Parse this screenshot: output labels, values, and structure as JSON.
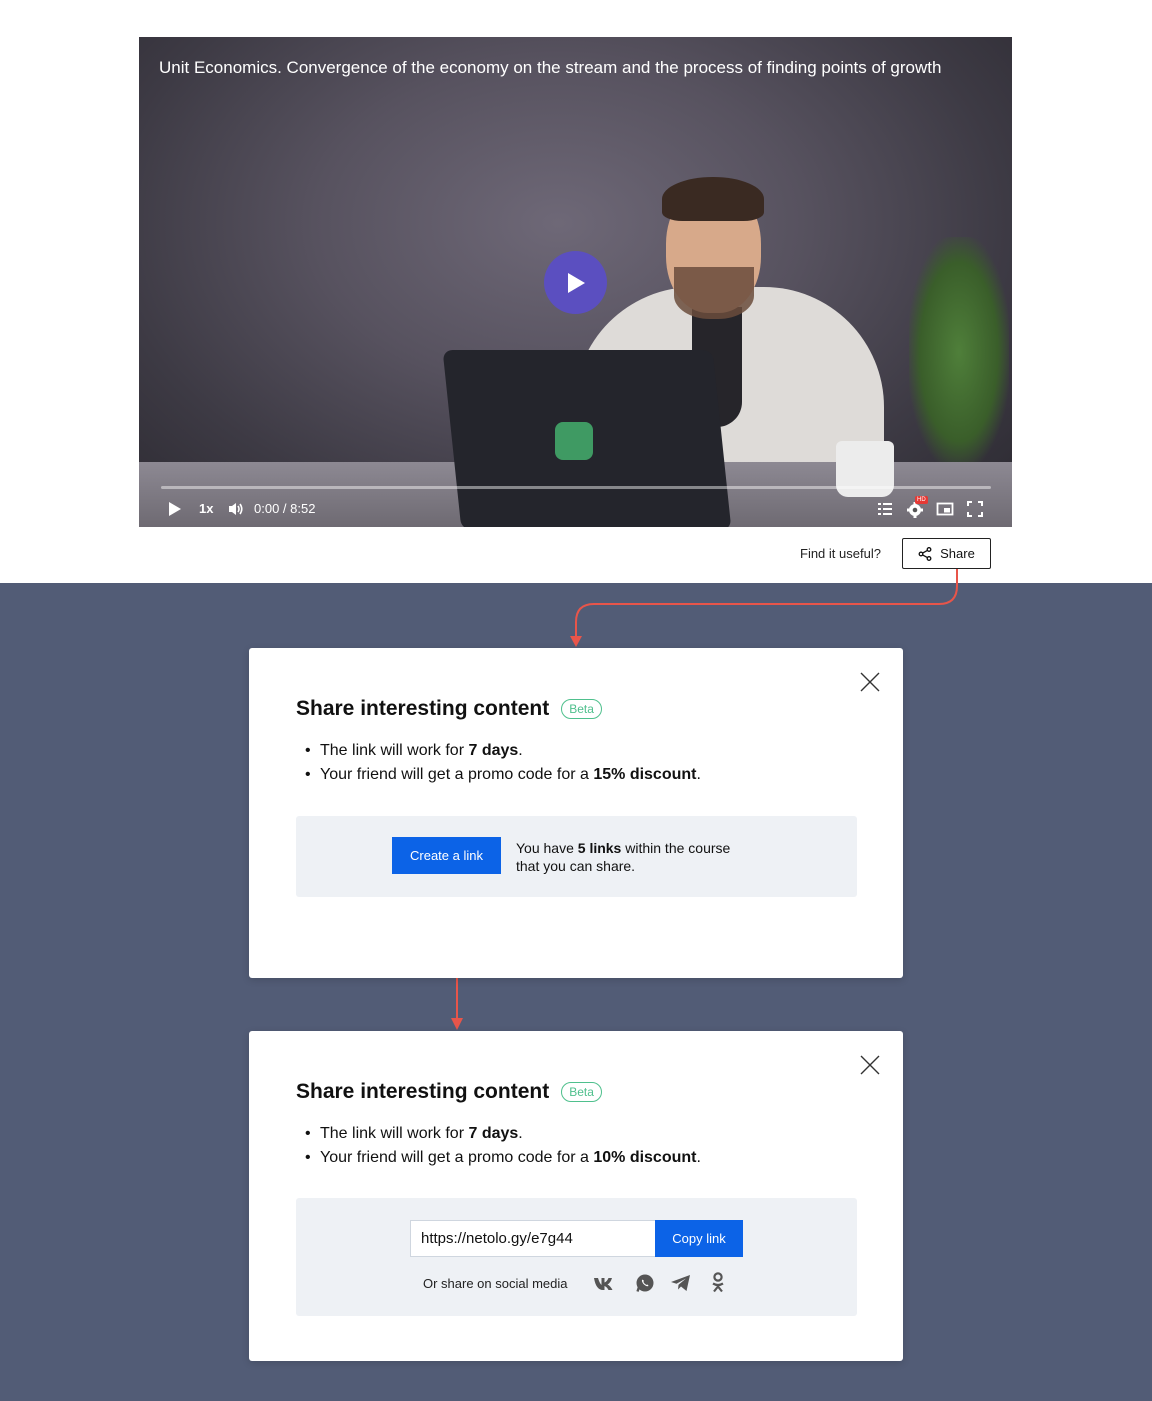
{
  "video": {
    "title": "Unit Economics. Convergence of the economy on the stream and the process of finding points of growth",
    "speed": "1x",
    "time": "0:00 / 8:52",
    "progress": 0,
    "hd_badge": "HD"
  },
  "feedback": {
    "prompt": "Find it useful?",
    "share_label": "Share"
  },
  "modal_create": {
    "title": "Share interesting content",
    "badge": "Beta",
    "bullet1_pre": "The link will work for ",
    "bullet1_bold": "7 days",
    "bullet1_post": ".",
    "bullet2_pre": "Your friend will get a promo code for a ",
    "bullet2_bold": "15% discount",
    "bullet2_post": ".",
    "create_label": "Create a link",
    "note_pre": "You have ",
    "note_bold": "5 links",
    "note_post": " within the course",
    "note_line2": "that you can share."
  },
  "modal_link": {
    "title": "Share interesting content",
    "badge": "Beta",
    "bullet1_pre": "The link will work for ",
    "bullet1_bold": "7 days",
    "bullet1_post": ".",
    "bullet2_pre": "Your friend will get a promo code for a ",
    "bullet2_bold": "10% discount",
    "bullet2_post": ".",
    "link_value": "https://netolo.gy/e7g44",
    "copy_label": "Copy link",
    "social_label": "Or share on social media",
    "socials": [
      "vk-icon",
      "whatsapp-icon",
      "telegram-icon",
      "odnoklassniki-icon"
    ]
  },
  "colors": {
    "accent": "#0c63e7",
    "beta": "#4fc08d",
    "arrow": "#e8554a",
    "backdrop": "#525c76",
    "play": "#5b4fc0"
  }
}
